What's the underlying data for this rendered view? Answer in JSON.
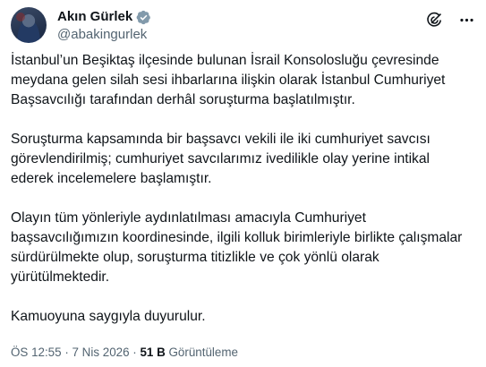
{
  "author": {
    "display_name": "Akın Gürlek",
    "handle": "@abakingurlek"
  },
  "icons": {
    "verified": "verified-badge-icon",
    "grok": "grok-icon",
    "more": "more-options-icon"
  },
  "colors": {
    "verified": "#829aab",
    "text": "#0f1419",
    "secondary": "#536471"
  },
  "tweet": {
    "paragraphs": [
      "İstanbul’un Beşiktaş ilçesinde bulunan İsrail Konsolosluğu çevresinde meydana gelen silah sesi ihbarlarına ilişkin olarak İstanbul Cumhuriyet Başsavcılığı tarafından derhâl soruşturma başlatılmıştır.",
      "Soruşturma kapsamında bir başsavcı vekili ile iki cumhuriyet savcısı görevlendirilmiş; cumhuriyet savcılarımız ivedilikle olay yerine intikal ederek incelemelere başlamıştır.",
      "Olayın tüm yönleriyle aydınlatılması amacıyla Cumhuriyet başsavcılığımızın koordinesinde, ilgili kolluk birimleriyle birlikte çalışmalar sürdürülmekte olup, soruşturma titizlikle ve çok yönlü olarak yürütülmektedir.",
      "Kamuoyuna saygıyla duyurulur."
    ]
  },
  "meta": {
    "time": "ÖS 12:55",
    "separator1": "·",
    "date": "7 Nis 2026",
    "separator2": "·",
    "views_count": "51 B",
    "views_label": "Görüntüleme"
  }
}
